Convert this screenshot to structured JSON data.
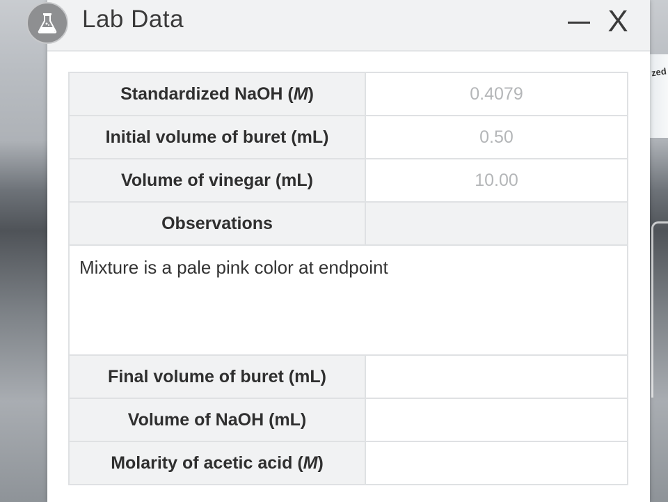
{
  "window": {
    "title": "Lab Data",
    "minimize_label": "—",
    "close_label": "X"
  },
  "background": {
    "bottle_label": "zed"
  },
  "table": {
    "rows": [
      {
        "label_pre": "Standardized NaOH (",
        "label_unit": "M",
        "label_post": ")",
        "value": "0.4079"
      },
      {
        "label": "Initial volume of buret (mL)",
        "value": "0.50"
      },
      {
        "label": "Volume of vinegar (mL)",
        "value": "10.00"
      },
      {
        "label": "Observations",
        "value": ""
      }
    ],
    "observations_text": "Mixture is a pale pink color at endpoint",
    "input_rows": [
      {
        "label": "Final volume of buret (mL)",
        "value": ""
      },
      {
        "label": "Volume of NaOH (mL)",
        "value": ""
      },
      {
        "label_pre": "Molarity of acetic acid (",
        "label_unit": "M",
        "label_post": ")",
        "value": ""
      }
    ]
  }
}
